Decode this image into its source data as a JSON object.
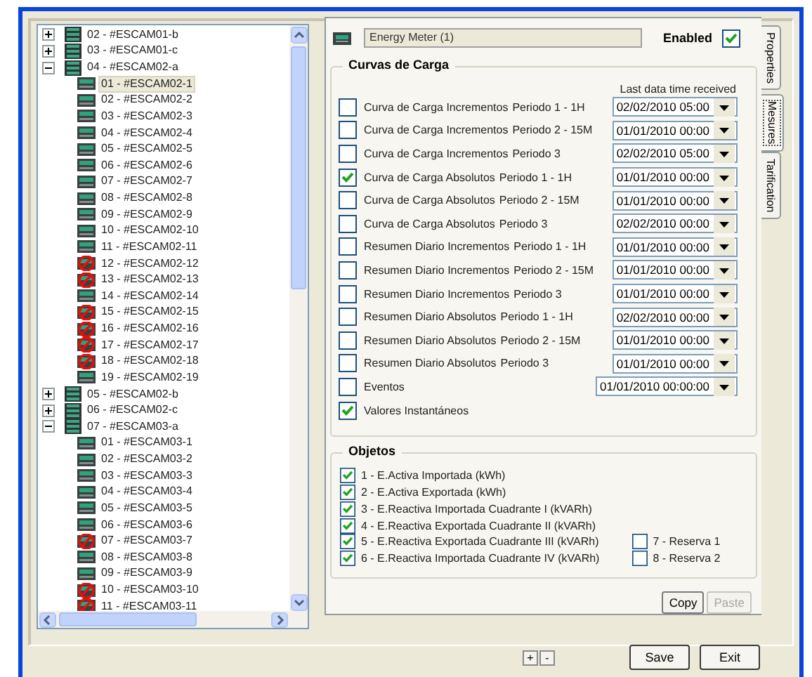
{
  "tree": {
    "items": [
      {
        "label": "02 - #ESCAM01-b",
        "expanded": false,
        "selected": false
      },
      {
        "label": "03 - #ESCAM01-c",
        "expanded": false,
        "selected": false
      },
      {
        "label": "04 - #ESCAM02-a",
        "expanded": true,
        "selected": false,
        "children": [
          {
            "label": "01 - #ESCAM02-1",
            "kind": "meter",
            "selected": true
          },
          {
            "label": "02 - #ESCAM02-2",
            "kind": "meter",
            "selected": false
          },
          {
            "label": "03 - #ESCAM02-3",
            "kind": "meter",
            "selected": false
          },
          {
            "label": "04 - #ESCAM02-4",
            "kind": "meter",
            "selected": false
          },
          {
            "label": "05 - #ESCAM02-5",
            "kind": "meter",
            "selected": false
          },
          {
            "label": "06 - #ESCAM02-6",
            "kind": "meter",
            "selected": false
          },
          {
            "label": "07 - #ESCAM02-7",
            "kind": "meter",
            "selected": false
          },
          {
            "label": "08 - #ESCAM02-8",
            "kind": "meter",
            "selected": false
          },
          {
            "label": "09 - #ESCAM02-9",
            "kind": "meter",
            "selected": false
          },
          {
            "label": "10 - #ESCAM02-10",
            "kind": "meter",
            "selected": false
          },
          {
            "label": "11 - #ESCAM02-11",
            "kind": "meter",
            "selected": false
          },
          {
            "label": "12 - #ESCAM02-12",
            "kind": "offline",
            "selected": false
          },
          {
            "label": "13 - #ESCAM02-13",
            "kind": "offline",
            "selected": false
          },
          {
            "label": "14 - #ESCAM02-14",
            "kind": "meter",
            "selected": false
          },
          {
            "label": "15 - #ESCAM02-15",
            "kind": "offline",
            "selected": false
          },
          {
            "label": "16 - #ESCAM02-16",
            "kind": "offline",
            "selected": false
          },
          {
            "label": "17 - #ESCAM02-17",
            "kind": "offline",
            "selected": false
          },
          {
            "label": "18 - #ESCAM02-18",
            "kind": "offline",
            "selected": false
          },
          {
            "label": "19 - #ESCAM02-19",
            "kind": "meter",
            "selected": false
          }
        ]
      },
      {
        "label": "05 - #ESCAM02-b",
        "expanded": false,
        "selected": false
      },
      {
        "label": "06 - #ESCAM02-c",
        "expanded": false,
        "selected": false
      },
      {
        "label": "07 - #ESCAM03-a",
        "expanded": true,
        "selected": false,
        "children": [
          {
            "label": "01 - #ESCAM03-1",
            "kind": "meter",
            "selected": false
          },
          {
            "label": "02 - #ESCAM03-2",
            "kind": "meter",
            "selected": false
          },
          {
            "label": "03 - #ESCAM03-3",
            "kind": "meter",
            "selected": false
          },
          {
            "label": "04 - #ESCAM03-4",
            "kind": "meter",
            "selected": false
          },
          {
            "label": "05 - #ESCAM03-5",
            "kind": "meter",
            "selected": false
          },
          {
            "label": "06 - #ESCAM03-6",
            "kind": "meter",
            "selected": false
          },
          {
            "label": "07 - #ESCAM03-7",
            "kind": "offline",
            "selected": false
          },
          {
            "label": "08 - #ESCAM03-8",
            "kind": "meter",
            "selected": false
          },
          {
            "label": "09 - #ESCAM03-9",
            "kind": "meter",
            "selected": false
          },
          {
            "label": "10 - #ESCAM03-10",
            "kind": "offline",
            "selected": false
          },
          {
            "label": "11 - #ESCAM03-11",
            "kind": "offline",
            "selected": false
          }
        ]
      }
    ]
  },
  "device": {
    "name": "Energy Meter (1)",
    "enabled_label": "Enabled",
    "enabled": true
  },
  "curvas": {
    "title": "Curvas de Carga",
    "column_header": "Last data time received",
    "rows": [
      {
        "label": "Curva de Carga Incrementos",
        "period": "Periodo 1 - 1H",
        "checked": false,
        "time": "02/02/2010 05:00"
      },
      {
        "label": "Curva de Carga Incrementos",
        "period": "Periodo 2 - 15M",
        "checked": false,
        "time": "01/01/2010 00:00"
      },
      {
        "label": "Curva de Carga Incrementos",
        "period": "Periodo 3",
        "checked": false,
        "time": "02/02/2010 05:00"
      },
      {
        "label": "Curva de Carga Absolutos",
        "period": "Periodo 1 - 1H",
        "checked": true,
        "time": "01/01/2010 00:00"
      },
      {
        "label": "Curva de Carga Absolutos",
        "period": "Periodo 2 - 15M",
        "checked": false,
        "time": "01/01/2010 00:00"
      },
      {
        "label": "Curva de Carga Absolutos",
        "period": "Periodo 3",
        "checked": false,
        "time": "02/02/2010 00:00"
      },
      {
        "label": "Resumen Diario Incrementos",
        "period": "Periodo 1 - 1H",
        "checked": false,
        "time": "01/01/2010 00:00"
      },
      {
        "label": "Resumen Diario Incrementos",
        "period": "Periodo 2 - 15M",
        "checked": false,
        "time": "01/01/2010 00:00"
      },
      {
        "label": "Resumen Diario Incrementos",
        "period": "Periodo 3",
        "checked": false,
        "time": "01/01/2010 00:00"
      },
      {
        "label": "Resumen Diario Absolutos",
        "period": "Periodo 1 - 1H",
        "checked": false,
        "time": "02/02/2010 00:00"
      },
      {
        "label": "Resumen Diario Absolutos",
        "period": "Periodo 2 - 15M",
        "checked": false,
        "time": "01/01/2010 00:00"
      },
      {
        "label": "Resumen Diario Absolutos",
        "period": "Periodo 3",
        "checked": false,
        "time": "01/01/2010 00:00"
      },
      {
        "label": "Eventos",
        "checked": false,
        "time": "01/01/2010 00:00:00"
      },
      {
        "label": "Valores Instantáneos",
        "checked": true
      }
    ]
  },
  "objetos": {
    "title": "Objetos",
    "items": [
      {
        "label": "1 - E.Activa Importada (kWh)",
        "checked": true
      },
      {
        "label": "2 - E.Activa Exportada (kWh)",
        "checked": true
      },
      {
        "label": "3 - E.Reactiva Importada Cuadrante I (kVARh)",
        "checked": true
      },
      {
        "label": "4 - E.Reactiva Exportada Cuadrante II (kVARh)",
        "checked": true
      },
      {
        "label": "5 - E.Reactiva Exportada Cuadrante III (kVARh)",
        "checked": true
      },
      {
        "label": "6 - E.Reactiva Importada Cuadrante IV (kVARh)",
        "checked": true
      }
    ],
    "reserved": [
      {
        "label": "7 - Reserva 1",
        "checked": false
      },
      {
        "label": "8 - Reserva 2",
        "checked": false
      }
    ]
  },
  "panel_buttons": [
    {
      "label": "Copy",
      "disabled": false
    },
    {
      "label": "Paste",
      "disabled": true
    }
  ],
  "tabs": [
    {
      "label": "Properties",
      "selected": false
    },
    {
      "label": "Mesures",
      "selected": true
    },
    {
      "label": "Tarification",
      "selected": false
    }
  ],
  "tree_buttons": [
    "+",
    "-"
  ],
  "dialog_buttons": [
    "Save",
    "Exit"
  ]
}
